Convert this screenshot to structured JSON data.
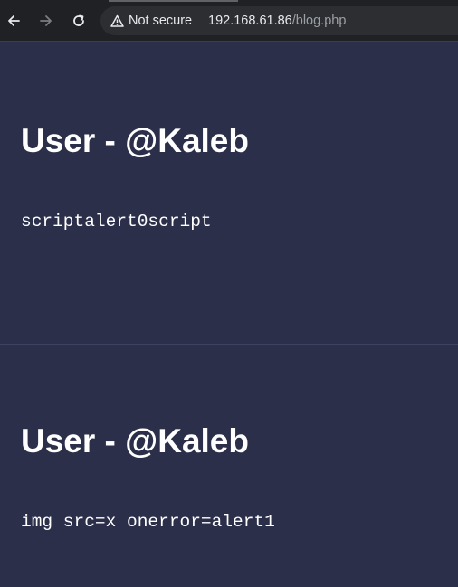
{
  "browser": {
    "security_label": "Not secure",
    "url_host": "192.168.61.86",
    "url_path": "/blog.php",
    "icons": [
      "back-arrow-icon",
      "forward-arrow-icon",
      "reload-icon",
      "warning-triangle-icon"
    ]
  },
  "posts": [
    {
      "title": "User - @Kaleb",
      "body": "scriptalert0script"
    },
    {
      "title": "User - @Kaleb",
      "body": "img src=x onerror=alert1"
    }
  ],
  "colors": {
    "page_background": "#2b2f4a",
    "text": "#ffffff",
    "browser_bar": "#202124"
  }
}
